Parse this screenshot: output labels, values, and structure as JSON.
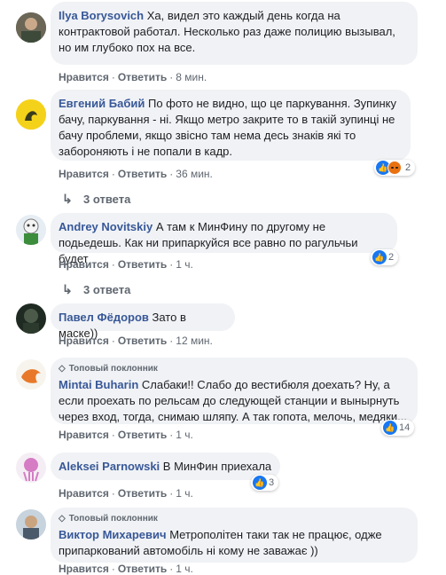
{
  "comments": [
    {
      "name": "Ilya Borysovich",
      "text": "Ха, видел это каждый день когда на контрактовой работал. Несколько раз даже полицию вызывал, но им глубоко пох на все.",
      "like": "Нравится",
      "reply": "Ответить",
      "time": "8 мин."
    },
    {
      "name": "Евгений Бабий",
      "text": "По фото не видно, що це паркування. Зупинку бачу, паркування - ні. Якщо метро закрите то в такій зупинці не бачу проблеми, якщо звісно там нема десь знаків які то забороняють і не попали в кадр.",
      "like": "Нравится",
      "reply": "Ответить",
      "time": "36 мин.",
      "reactions": "2",
      "replies": "3 ответа"
    },
    {
      "name": "Andrey Novitskiy",
      "text": "А там к МинФину по другому не подьедешь. Как ни припаркуйся все равно по рагульчьи будет",
      "like": "Нравится",
      "reply": "Ответить",
      "time": "1 ч.",
      "reactions": "2",
      "replies": "3 ответа"
    },
    {
      "name": "Павел Фёдоров",
      "text": "Зато в маске))",
      "like": "Нравится",
      "reply": "Ответить",
      "time": "12 мин."
    },
    {
      "badge": "Топовый поклонник",
      "name": "Mintai Buharin",
      "text": "Слабаки!! Слабо до вестибюля доехать? Ну, а если проехать по рельсам до следующей станции и вынырнуть через вход, тогда, снимаю шляпу. А так гопота, мелочь, медяки...",
      "like": "Нравится",
      "reply": "Ответить",
      "time": "1 ч.",
      "reactions": "14"
    },
    {
      "name": "Aleksei Parnowski",
      "text": "В МинФин приехала",
      "like": "Нравится",
      "reply": "Ответить",
      "time": "1 ч.",
      "reactions": "3"
    },
    {
      "badge": "Топовый поклонник",
      "name": "Виктор Михаревич",
      "text": "Метрополітен таки так не працює, одже припаркований автомобіль ні кому не заважає ))",
      "like": "Нравится",
      "reply": "Ответить",
      "time": "1 ч."
    }
  ]
}
